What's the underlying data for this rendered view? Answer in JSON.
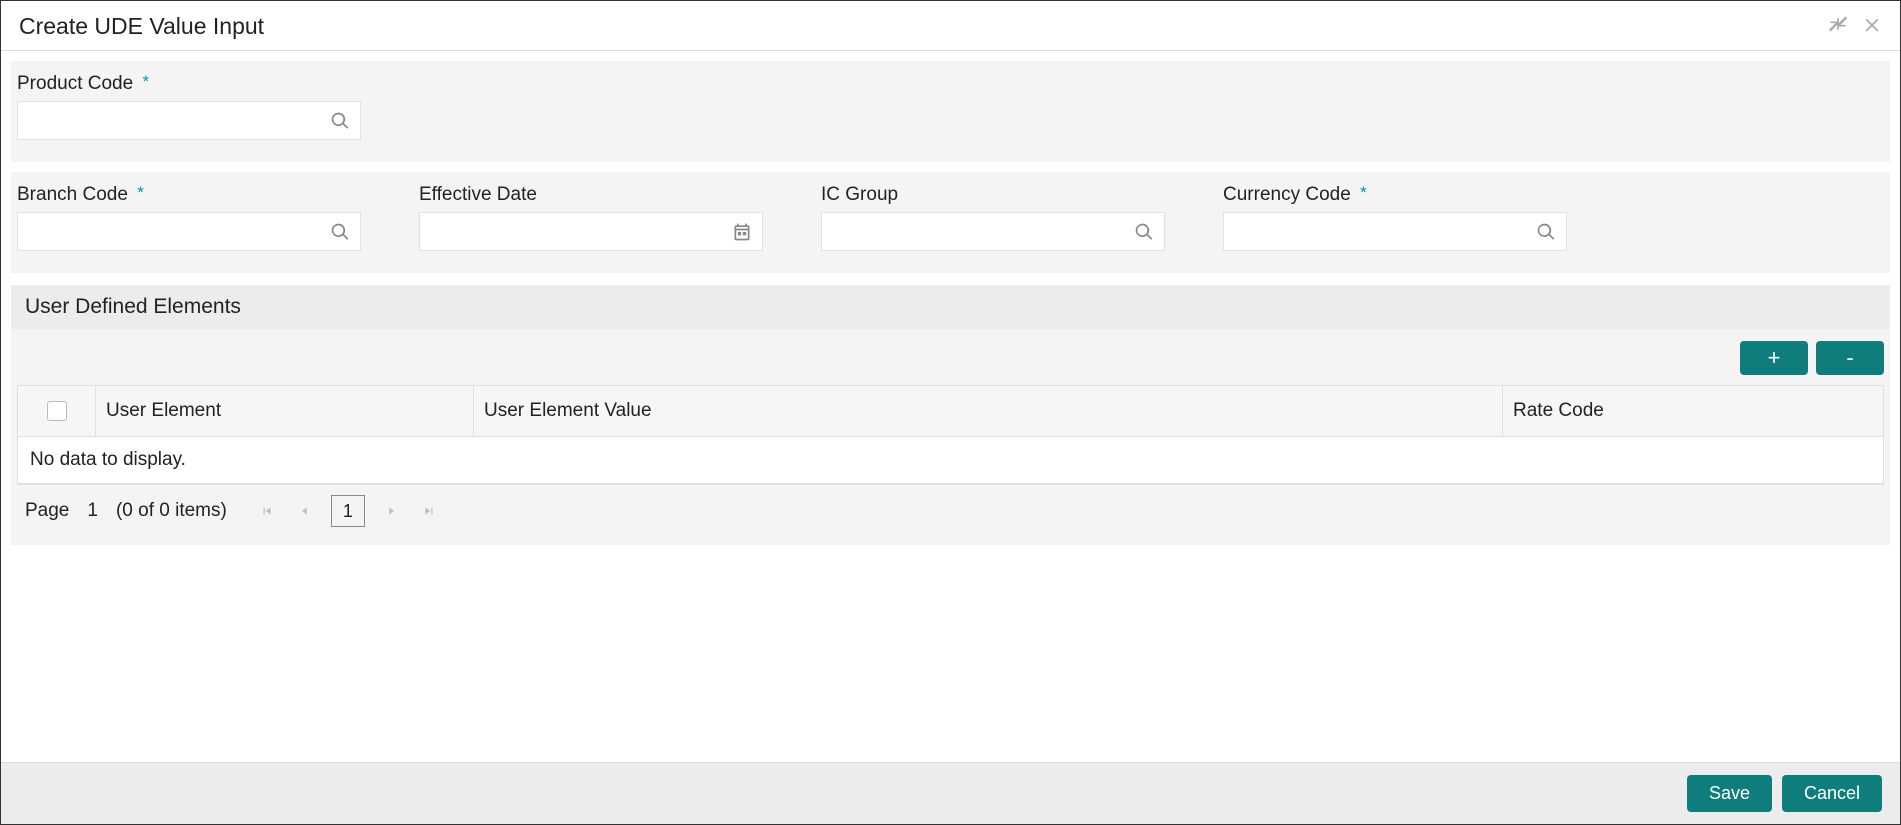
{
  "header": {
    "title": "Create UDE Value Input"
  },
  "fields": {
    "product_code": {
      "label": "Product Code",
      "required": "*",
      "value": ""
    },
    "branch_code": {
      "label": "Branch Code",
      "required": "*",
      "value": ""
    },
    "effective_date": {
      "label": "Effective Date",
      "value": ""
    },
    "ic_group": {
      "label": "IC Group",
      "value": ""
    },
    "currency_code": {
      "label": "Currency Code",
      "required": "*",
      "value": ""
    }
  },
  "ude": {
    "section_title": "User Defined Elements",
    "add_label": "+",
    "remove_label": "-",
    "columns": {
      "user_element": "User Element",
      "user_element_value": "User Element Value",
      "rate_code": "Rate Code"
    },
    "empty_text": "No data to display.",
    "pagination": {
      "page_label": "Page",
      "current_page": "1",
      "items_text": "(0 of 0 items)",
      "pg_num": "1"
    }
  },
  "footer": {
    "save": "Save",
    "cancel": "Cancel"
  }
}
